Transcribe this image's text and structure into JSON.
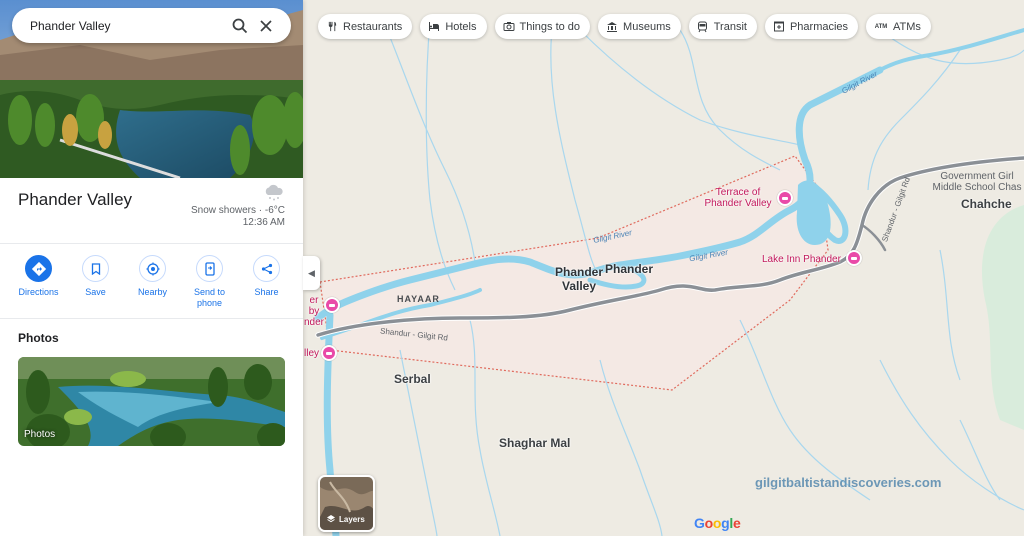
{
  "search": {
    "value": "Phander Valley"
  },
  "chips": [
    {
      "icon": "restaurant-icon",
      "label": "Restaurants"
    },
    {
      "icon": "hotel-icon",
      "label": "Hotels"
    },
    {
      "icon": "camera-icon",
      "label": "Things to do"
    },
    {
      "icon": "museum-icon",
      "label": "Museums"
    },
    {
      "icon": "transit-icon",
      "label": "Transit"
    },
    {
      "icon": "pharmacy-icon",
      "label": "Pharmacies"
    },
    {
      "icon": "atm-icon",
      "label": "ATMs"
    }
  ],
  "place": {
    "title": "Phander Valley",
    "weather": {
      "condition": "Snow showers · -6°C",
      "time": "12:36 AM",
      "icon": "snow-cloud-icon"
    }
  },
  "actions": [
    {
      "label": "Directions",
      "icon": "directions-icon"
    },
    {
      "label": "Save",
      "icon": "bookmark-icon"
    },
    {
      "label": "Nearby",
      "icon": "nearby-icon"
    },
    {
      "label": "Send to phone",
      "icon": "phone-icon"
    },
    {
      "label": "Share",
      "icon": "share-icon"
    }
  ],
  "photos": {
    "heading": "Photos",
    "card_label": "Photos"
  },
  "layers": {
    "label": "Layers"
  },
  "map": {
    "towns": {
      "phander_valley": "Phander Valley",
      "phander": "Phander",
      "chahche": "Chahche",
      "serbal": "Serbal",
      "shaghar_mal": "Shaghar Mal",
      "hayaar": "HAYAAR"
    },
    "rivers": {
      "gilgit_river_1": "Gilgit River",
      "gilgit_river_2": "Gilgit River",
      "gilgit_river_3": "Gilgit River"
    },
    "roads": {
      "shandur_gilgit_rd": "Shandur - Gilgit Rd",
      "shandur_gilgit_rd_2": "Shandur - Gilgit Rd"
    },
    "pois": {
      "terrace": "Terrace of Phander Valley",
      "lake_inn": "Lake Inn Phander",
      "left_hotel_1": "er by nder",
      "left_hotel_2": "lley"
    },
    "school": "Government Girl Middle School Chas",
    "colors": {
      "water": "#8fd2eb",
      "road": "#8b9096",
      "boundary": "#e06a5d",
      "land": "#eeebe3"
    }
  },
  "watermark": "gilgitbaltistandiscoveries.com",
  "google_logo": {
    "letters": [
      "G",
      "o",
      "o",
      "g",
      "l",
      "e"
    ],
    "colors": [
      "#4285f4",
      "#ea4335",
      "#fbbc05",
      "#4285f4",
      "#34a853",
      "#ea4335"
    ]
  }
}
